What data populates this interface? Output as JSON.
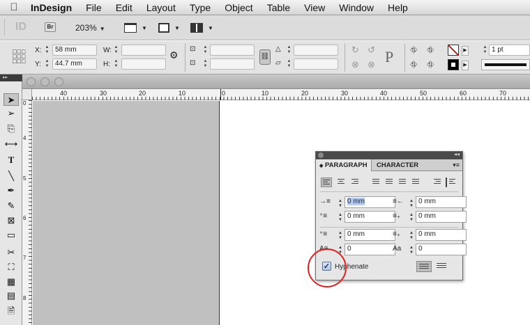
{
  "menubar": {
    "apple": "",
    "app_name": "InDesign",
    "items": [
      "File",
      "Edit",
      "Layout",
      "Type",
      "Object",
      "Table",
      "View",
      "Window",
      "Help"
    ]
  },
  "appbar": {
    "logo": "ID",
    "bridge": "Br",
    "zoom": "203%"
  },
  "control": {
    "x_label": "X:",
    "x_value": "58 mm",
    "y_label": "Y:",
    "y_value": "44.7 mm",
    "w_label": "W:",
    "w_value": "",
    "h_label": "H:",
    "h_value": "",
    "stroke_weight": "1 pt"
  },
  "rulers": {
    "h_ticks": [
      "40",
      "30",
      "20",
      "10",
      "0",
      "10",
      "20",
      "30",
      "40",
      "50",
      "60",
      "70"
    ],
    "v_ticks": [
      "0",
      "1",
      "4",
      "5",
      "6",
      "7",
      "8"
    ]
  },
  "paragraph_panel": {
    "tab_paragraph": "PARAGRAPH",
    "tab_character": "CHARACTER",
    "left_indent": "0 mm",
    "right_indent": "0 mm",
    "first_line_indent": "0 mm",
    "last_line_indent": "0 mm",
    "space_before": "0 mm",
    "space_after": "0 mm",
    "drop_cap_lines": "0",
    "drop_cap_chars": "0",
    "hyphenate_label": "Hyphenate",
    "hyphenate_checked": true
  },
  "colors": {
    "pasteboard": "#c0c0c0",
    "highlight_circle": "#e02020"
  }
}
